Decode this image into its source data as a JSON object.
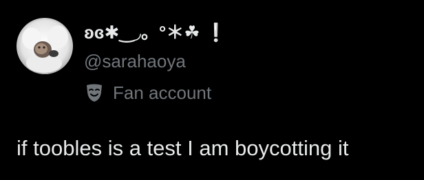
{
  "author": {
    "display_name": "ʚɞ✱‿◞。°＊☘ ❕",
    "handle": "@sarahaoya",
    "avatar_icon": "avatar-fur-hood"
  },
  "label": {
    "icon": "theater-mask-icon",
    "text": "Fan account"
  },
  "tweet": {
    "text": "if toobles is a test I am boycotting it"
  },
  "colors": {
    "background": "#000000",
    "primary_text": "#e7e9ea",
    "secondary_text": "#71767b",
    "clover_green": "#2f9e44"
  }
}
